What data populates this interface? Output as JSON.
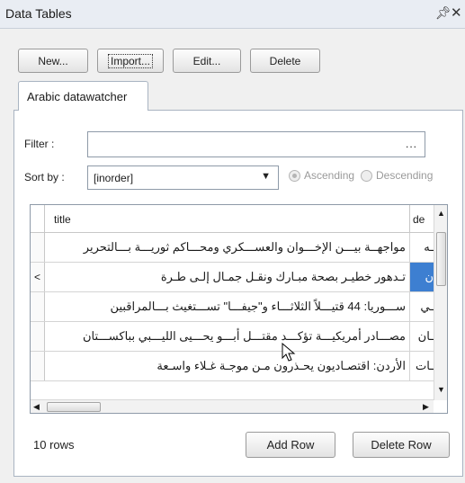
{
  "window": {
    "title": "Data Tables",
    "pin_icon": "pin-icon",
    "close_icon": "close-icon"
  },
  "toolbar": {
    "new_label": "New...",
    "import_label": "Import...",
    "edit_label": "Edit...",
    "delete_label": "Delete"
  },
  "tabs": [
    {
      "label": "Arabic datawatcher"
    }
  ],
  "filter": {
    "label": "Filter :",
    "value": "",
    "browse_label": "..."
  },
  "sort": {
    "label": "Sort by :",
    "selected": "[inorder]",
    "ascending_label": "Ascending",
    "descending_label": "Descending"
  },
  "table": {
    "columns": [
      "title",
      "de"
    ],
    "rows": [
      {
        "indicator": "",
        "title": "مواجهــة بيـــن الإخـــوان والعســـكري ومحـــاكم ثوريـــة بـــالتحرير",
        "de": "ـه"
      },
      {
        "indicator": "<",
        "title": "تـدهور خطيـر بصحة مبـارك ونقـل جمـال إلـى طـرة",
        "de": "ن"
      },
      {
        "indicator": "",
        "title": "ســـوريا: 44 قتيـــلاً الثلاثـــاء و\"جيفـــا\" تســـتغيث بـــالمراقبين",
        "de": "ـي"
      },
      {
        "indicator": "",
        "title": "مصـــادر أمريكيـــة تؤكـــد مقتـــل أبـــو يحـــيى الليـــبي بباكســـتان",
        "de": "ـان"
      },
      {
        "indicator": "",
        "title": "الأردن: اقتصـاديون يحـذرون مـن موجـة غـلاء واسـعة",
        "de": "ـات"
      }
    ]
  },
  "footer": {
    "row_count": "10 rows",
    "add_row_label": "Add Row",
    "delete_row_label": "Delete Row"
  }
}
